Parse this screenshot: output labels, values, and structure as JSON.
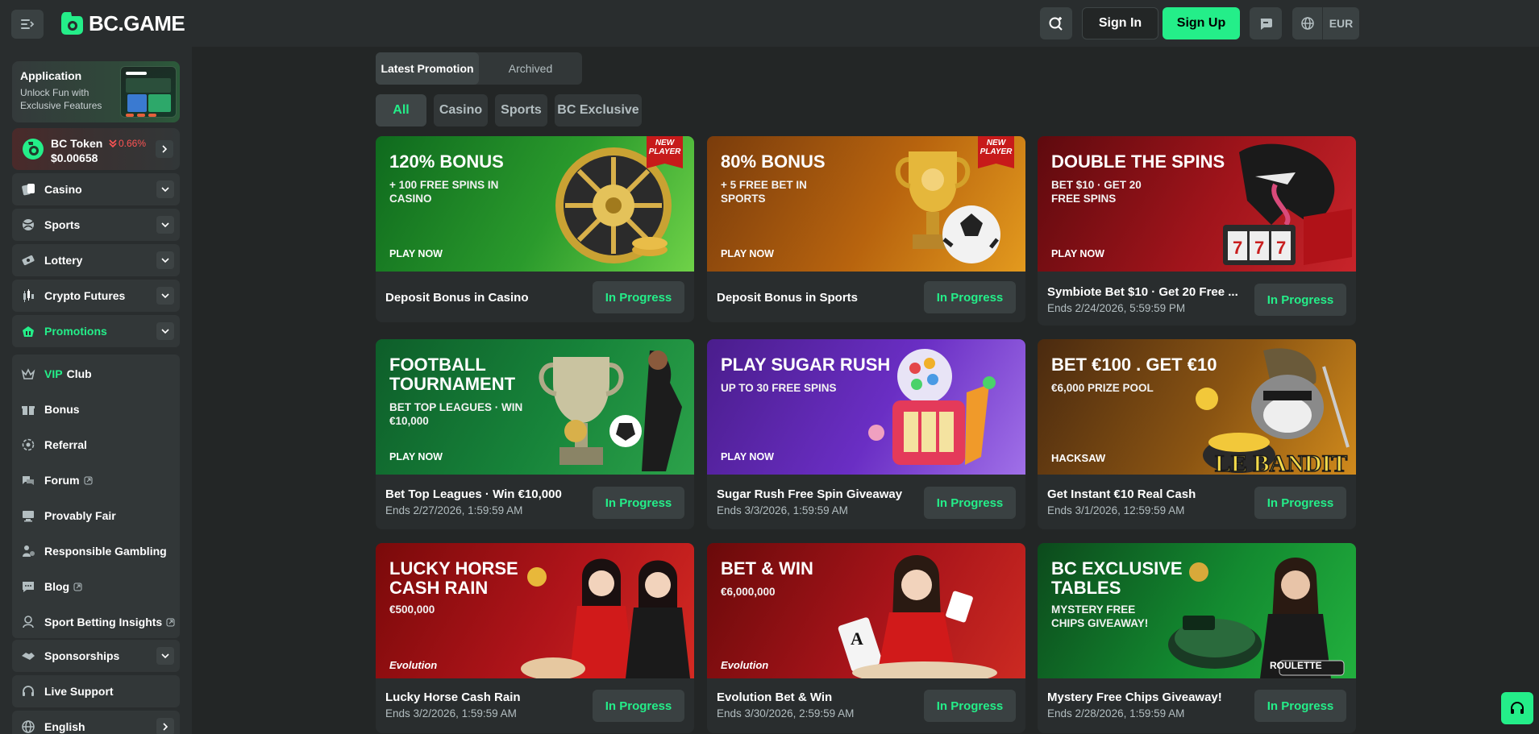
{
  "header": {
    "logo_text": "BC.GAME",
    "sign_in": "Sign In",
    "sign_up": "Sign Up",
    "currency": "EUR",
    "accent": "#24ee89"
  },
  "sidebar": {
    "app_promo": {
      "title": "Application",
      "description": "Unlock Fun with Exclusive Features"
    },
    "token": {
      "name": "BC Token",
      "change": "0.66%",
      "price": "$0.00658"
    },
    "nav": [
      {
        "label": "Casino",
        "icon": "casino-icon"
      },
      {
        "label": "Sports",
        "icon": "sports-icon"
      },
      {
        "label": "Lottery",
        "icon": "lottery-icon"
      },
      {
        "label": "Crypto Futures",
        "icon": "crypto-futures-icon"
      },
      {
        "label": "Promotions",
        "icon": "promotions-icon",
        "active": true
      }
    ],
    "group": [
      {
        "label_prefix": "VIP",
        "label": "Club",
        "icon": "crown-icon"
      },
      {
        "label": "Bonus",
        "icon": "gift-icon"
      },
      {
        "label": "Referral",
        "icon": "referral-icon"
      },
      {
        "label": "Forum",
        "icon": "forum-icon",
        "external": true
      },
      {
        "label": "Provably Fair",
        "icon": "provably-fair-icon"
      },
      {
        "label": "Responsible Gambling",
        "icon": "responsible-gambling-icon"
      },
      {
        "label": "Blog",
        "icon": "blog-icon",
        "external": true
      },
      {
        "label": "Sport Betting Insights",
        "icon": "insights-icon",
        "external": true
      }
    ],
    "bottom": [
      {
        "label": "Sponsorships",
        "icon": "sponsorships-icon"
      },
      {
        "label": "Live Support",
        "icon": "headset-icon"
      },
      {
        "label": "English",
        "icon": "globe-icon"
      }
    ]
  },
  "tabs": {
    "latest": "Latest Promotion",
    "archived": "Archived"
  },
  "filters": [
    "All",
    "Casino",
    "Sports",
    "BC Exclusive"
  ],
  "promotions": [
    {
      "banner_title": "120% BONUS",
      "banner_sub": "+ 100 FREE SPINS IN CASINO",
      "banner_cta": "PLAY NOW",
      "badge": "NEW PLAYER",
      "title": "Deposit Bonus in Casino",
      "date": "",
      "status": "In Progress"
    },
    {
      "banner_title": "80% BONUS",
      "banner_sub": "+ 5 FREE BET IN SPORTS",
      "banner_cta": "PLAY NOW",
      "badge": "NEW PLAYER",
      "title": "Deposit Bonus in Sports",
      "date": "",
      "status": "In Progress"
    },
    {
      "banner_title": "DOUBLE THE SPINS",
      "banner_sub": "BET $10 · GET 20 FREE SPINS",
      "banner_cta": "PLAY NOW",
      "badge": "",
      "title": "Symbiote Bet $10 · Get 20 Free ...",
      "date": "Ends 2/24/2026, 5:59:59 PM",
      "status": "In Progress"
    },
    {
      "banner_title": "FOOTBALL TOURNAMENT",
      "banner_sub": "BET TOP LEAGUES · WIN €10,000",
      "banner_cta": "PLAY NOW",
      "badge": "",
      "title": "Bet Top Leagues · Win €10,000",
      "date": "Ends 2/27/2026, 1:59:59 AM",
      "status": "In Progress"
    },
    {
      "banner_title": "PLAY SUGAR RUSH",
      "banner_sub": "UP TO 30 FREE SPINS",
      "banner_cta": "PLAY NOW",
      "badge": "",
      "title": "Sugar Rush Free Spin Giveaway",
      "date": "Ends 3/3/2026, 1:59:59 AM",
      "status": "In Progress"
    },
    {
      "banner_title": "BET €100 . GET €10",
      "banner_sub": "€6,000 PRIZE POOL",
      "banner_cta": "HACKSAW",
      "badge": "",
      "title": "Get Instant €10 Real Cash",
      "date": "Ends 3/1/2026, 12:59:59 AM",
      "status": "In Progress"
    },
    {
      "banner_title": "LUCKY HORSE CASH RAIN",
      "banner_sub": "€500,000",
      "banner_cta": "Evolution",
      "badge": "",
      "title": "Lucky Horse Cash Rain",
      "date": "Ends 3/2/2026, 1:59:59 AM",
      "status": "In Progress"
    },
    {
      "banner_title": "BET & WIN",
      "banner_sub": "€6,000,000",
      "banner_cta": "Evolution",
      "badge": "",
      "title": "Evolution Bet & Win",
      "date": "Ends 3/30/2026, 2:59:59 AM",
      "status": "In Progress"
    },
    {
      "banner_title": "BC EXCLUSIVE TABLES",
      "banner_sub": "MYSTERY FREE CHIPS GIVEAWAY!",
      "banner_cta": "ROULETTE",
      "badge": "",
      "title": "Mystery Free Chips Giveaway!",
      "date": "Ends 2/28/2026, 1:59:59 AM",
      "status": "In Progress"
    }
  ]
}
